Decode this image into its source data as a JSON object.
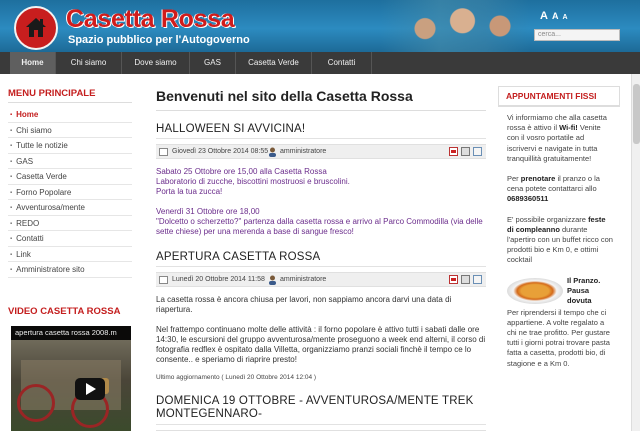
{
  "header": {
    "title": "Casetta Rossa",
    "subtitle": "Spazio pubblico per l'Autogoverno",
    "font_sizes": [
      "A",
      "A",
      "A"
    ],
    "search_placeholder": "cerca..."
  },
  "nav": {
    "items": [
      "Home",
      "Chi siamo",
      "Dove siamo",
      "GAS",
      "Casetta Verde",
      "Contatti"
    ],
    "active": "Home"
  },
  "left": {
    "menu_title": "MENU PRINCIPALE",
    "menu": [
      "Home",
      "Chi siamo",
      "Tutte le notizie",
      "GAS",
      "Casetta Verde",
      "Forno Popolare",
      "Avventurosa/mente",
      "REDO",
      "Contatti",
      "Link",
      "Amministratore sito"
    ],
    "video_title": "VIDEO CASETTA ROSSA",
    "video_caption": "apertura casetta rossa 2008.m"
  },
  "main": {
    "heading": "Benvenuti nel sito della Casetta Rossa",
    "articles": [
      {
        "title": "HALLOWEEN SI AVVICINA!",
        "date": "Giovedì 23 Ottobre 2014 08:55",
        "author": "amministratore",
        "p1": [
          "Sabato 25 Ottobre ore 15,00 alla Casetta  Rossa",
          "Laboratorio di zucche, biscottini mostruosi e bruscolini.",
          "Porta la tua zucca!"
        ],
        "p2": [
          "Venerdì 31 Ottobre ore 18,00",
          "\"Dolcetto o scherzetto?\" partenza dalla casetta rossa e arrivo al Parco Commodilla (via delle sette chiese) per una merenda a base di sangue fresco!"
        ]
      },
      {
        "title": "APERTURA CASETTA ROSSA",
        "date": "Lunedì 20 Ottobre 2014 11:58",
        "author": "amministratore",
        "p1": "La casetta rossa è ancora chiusa per lavori, non sappiamo ancora darvi una data di riapertura.",
        "p2": "Nel frattempo continuano molte delle attività : il forno popolare è attivo tutti i sabati dalle ore 14:30, le escursioni del gruppo avventurosa/mente proseguono a week end alterni, il corso di fotografia redflex è ospitato dalla Villetta, organizziamo pranzi sociali finchè il tempo ce lo consente.. e speriamo di riaprire presto!",
        "updated": "Ultimo aggiornamento ( Lunedì 20 Ottobre 2014 12:04 )"
      },
      {
        "title": "DOMENICA 19 OTTOBRE - AVVENTUROSA/MENTE TREK MONTEGENNARO-"
      }
    ]
  },
  "right": {
    "title": "APPUNTAMENTI FISSI",
    "wifi_pre": "Vi informiamo che alla casetta rossa è attivo il ",
    "wifi_bold": "Wi-fi!",
    "wifi_post": " Venite con il vosro portatile ad iscrivervi e navigate in tutta tranquillità gratuitamente!",
    "pren_pre": "Per ",
    "pren_bold": "prenotare",
    "pren_post": " il pranzo o la cena potete contattarci allo ",
    "phone": "0689360511",
    "comp_pre": "E' possibile organizzare ",
    "comp_bold": "feste di compleanno",
    "comp_post": " durante l'apertiro con un buffet ricco con prodotti bio e Km 0, e ottimi cocktail",
    "pasta_title": "Il Pranzo. Pausa dovuta",
    "pasta_text": "Per riprendersi il tempo che ci appartiene. A volte regalato a chi ne trae profitto. Per gustare tutti i giorni potrai trovare pasta fatta  a casetta, prodotti bio, di stagione e a Km 0."
  },
  "colors": {
    "brand_red": "#c41e1e",
    "header_blue": "#2c8bc0",
    "nav_dark": "#3a3a3a",
    "event_purple": "#6b2d8c"
  }
}
